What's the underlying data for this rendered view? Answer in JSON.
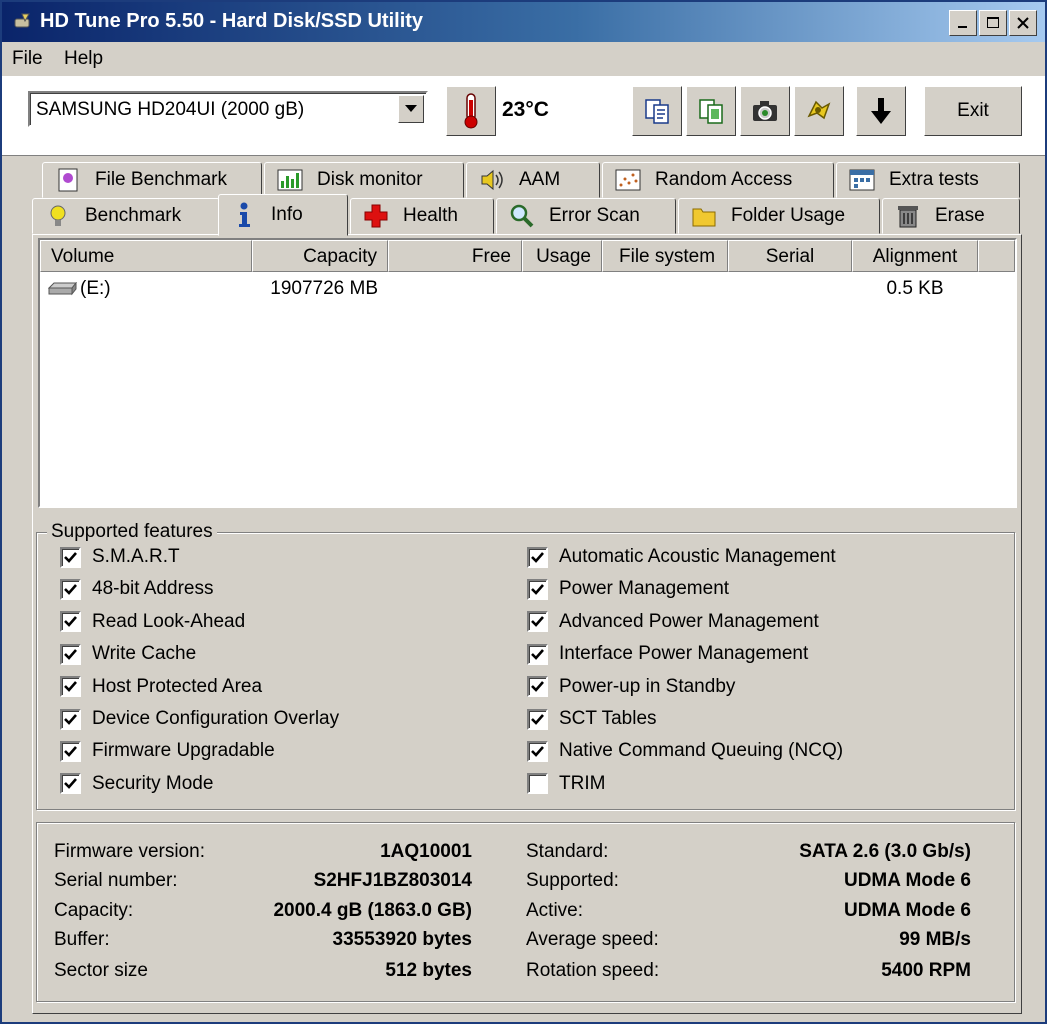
{
  "window": {
    "title": "HD Tune Pro 5.50 - Hard Disk/SSD Utility",
    "controls": {
      "minimize": "minimize",
      "maximize": "maximize",
      "close": "close"
    }
  },
  "menu": {
    "file": "File",
    "help": "Help"
  },
  "toolbar": {
    "drive_select": "SAMSUNG HD204UI (2000 gB)",
    "temperature": "23°C",
    "exit_label": "Exit",
    "icons": [
      "copy-text-icon",
      "copy-info-icon",
      "screenshot-icon",
      "options-icon",
      "save-icon"
    ]
  },
  "tabs": {
    "row1": [
      {
        "label": "File Benchmark",
        "icon": "file-benchmark-icon"
      },
      {
        "label": "Disk monitor",
        "icon": "disk-monitor-icon"
      },
      {
        "label": "AAM",
        "icon": "speaker-icon"
      },
      {
        "label": "Random Access",
        "icon": "random-access-icon"
      },
      {
        "label": "Extra tests",
        "icon": "extra-tests-icon"
      }
    ],
    "row2": [
      {
        "label": "Benchmark",
        "icon": "lightbulb-icon"
      },
      {
        "label": "Info",
        "icon": "info-icon",
        "active": true
      },
      {
        "label": "Health",
        "icon": "health-cross-icon"
      },
      {
        "label": "Error Scan",
        "icon": "magnifier-icon"
      },
      {
        "label": "Folder Usage",
        "icon": "folder-icon"
      },
      {
        "label": "Erase",
        "icon": "trash-icon"
      }
    ]
  },
  "volumes": {
    "columns": [
      "Volume",
      "Capacity",
      "Free",
      "Usage",
      "File system",
      "Serial",
      "Alignment"
    ],
    "rows": [
      {
        "volume": "(E:)",
        "capacity": "1907726 MB",
        "free": "",
        "usage": "",
        "file_system": "",
        "serial": "",
        "alignment": "0.5 KB"
      }
    ]
  },
  "features": {
    "legend": "Supported features",
    "left": [
      {
        "label": "S.M.A.R.T",
        "checked": true
      },
      {
        "label": "48-bit Address",
        "checked": true
      },
      {
        "label": "Read Look-Ahead",
        "checked": true
      },
      {
        "label": "Write Cache",
        "checked": true
      },
      {
        "label": "Host Protected Area",
        "checked": true
      },
      {
        "label": "Device Configuration Overlay",
        "checked": true
      },
      {
        "label": "Firmware Upgradable",
        "checked": true
      },
      {
        "label": "Security Mode",
        "checked": true
      }
    ],
    "right": [
      {
        "label": "Automatic Acoustic Management",
        "checked": true
      },
      {
        "label": "Power Management",
        "checked": true
      },
      {
        "label": "Advanced Power Management",
        "checked": true
      },
      {
        "label": "Interface Power Management",
        "checked": true
      },
      {
        "label": "Power-up in Standby",
        "checked": true
      },
      {
        "label": "SCT Tables",
        "checked": true
      },
      {
        "label": "Native Command Queuing (NCQ)",
        "checked": true
      },
      {
        "label": "TRIM",
        "checked": false
      }
    ]
  },
  "details": {
    "left": [
      {
        "label": "Firmware version:",
        "value": "1AQ10001"
      },
      {
        "label": "Serial number:",
        "value": "S2HFJ1BZ803014"
      },
      {
        "label": "Capacity:",
        "value": "2000.4 gB (1863.0 GB)"
      },
      {
        "label": "Buffer:",
        "value": "33553920 bytes"
      },
      {
        "label": "Sector size",
        "value": "512 bytes"
      }
    ],
    "right": [
      {
        "label": "Standard:",
        "value": "SATA 2.6 (3.0 Gb/s)"
      },
      {
        "label": "Supported:",
        "value": "UDMA Mode 6"
      },
      {
        "label": "Active:",
        "value": "UDMA Mode 6"
      },
      {
        "label": "Average speed:",
        "value": "99 MB/s"
      },
      {
        "label": "Rotation speed:",
        "value": "5400 RPM"
      }
    ]
  },
  "colors": {
    "titlebar_start": "#0a246a",
    "titlebar_end": "#a6caf0",
    "face": "#d4d0c8",
    "accent_red": "#cc0000"
  }
}
